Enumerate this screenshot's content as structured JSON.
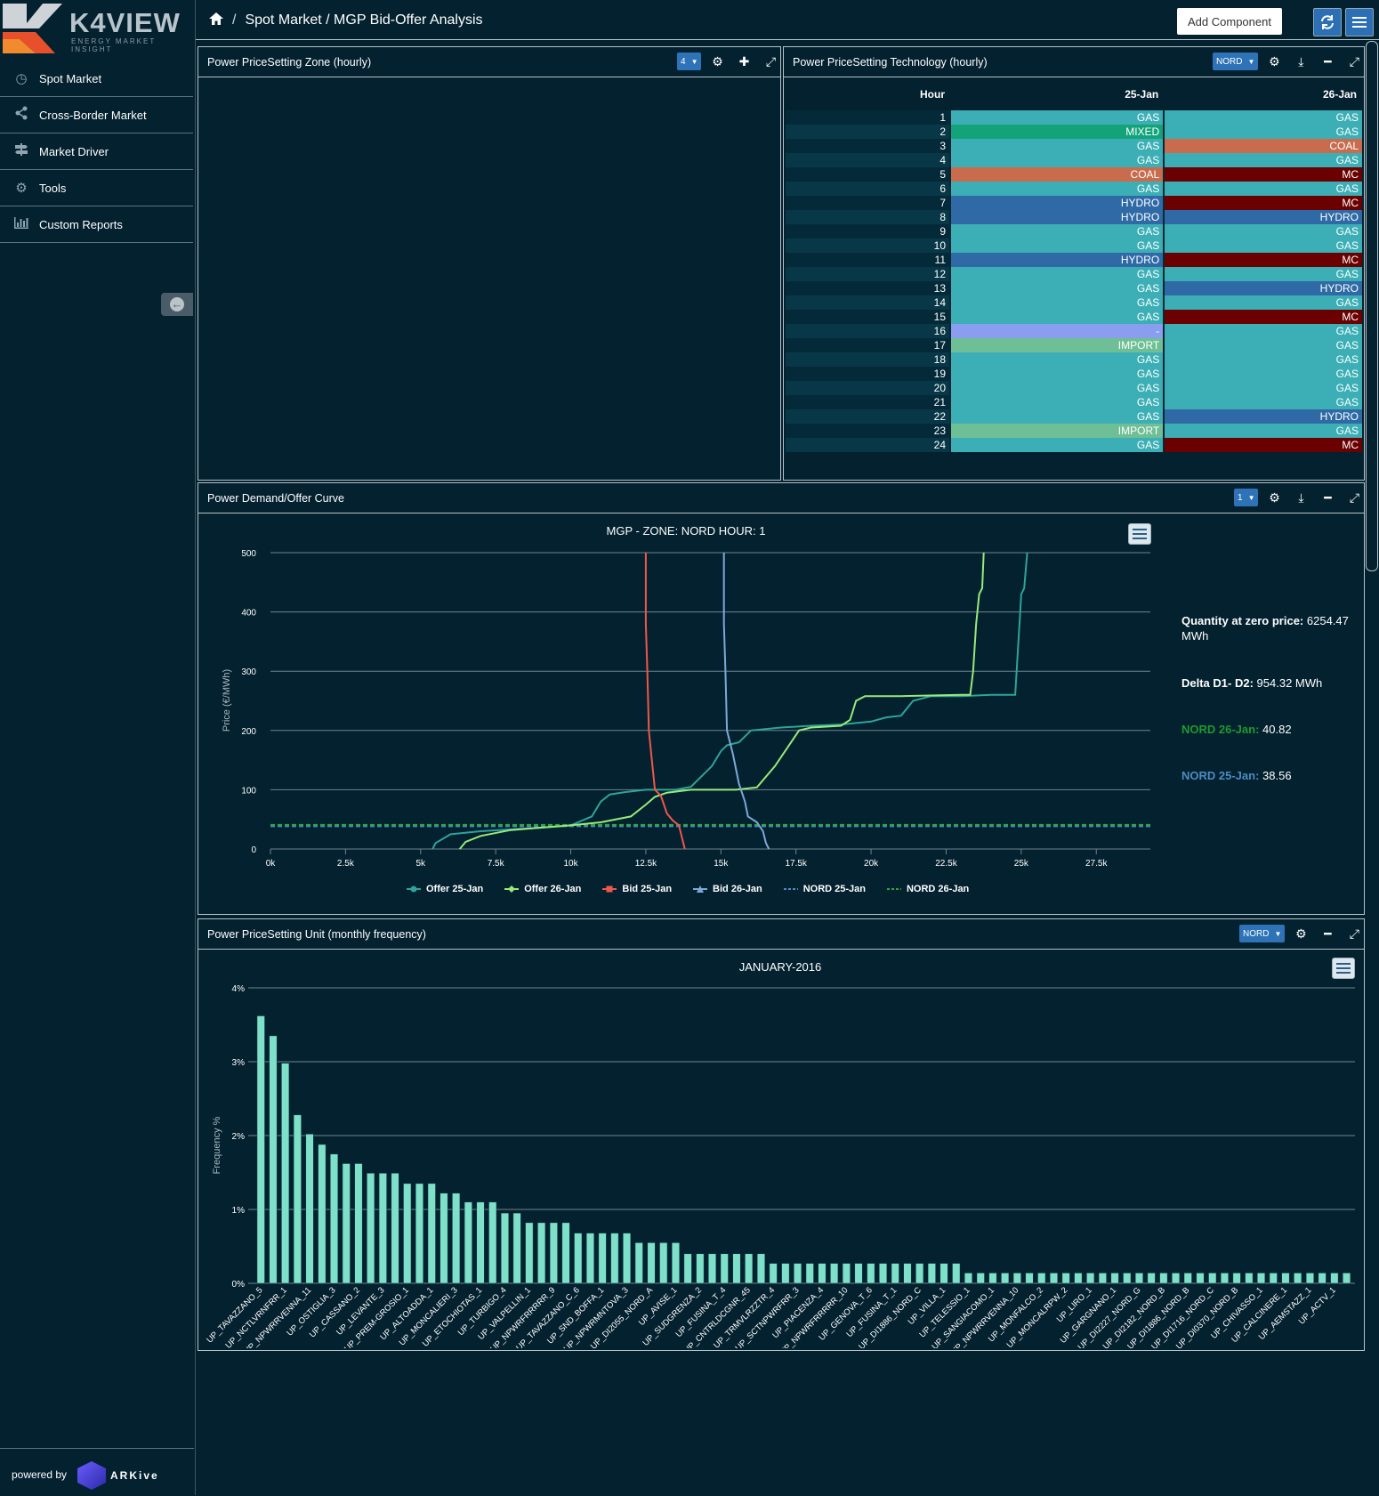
{
  "brand": {
    "name": "K4VIEW",
    "tagline": "ENERGY MARKET INSIGHT"
  },
  "sidebar": {
    "items": [
      {
        "label": "Spot Market",
        "icon": "clock-icon"
      },
      {
        "label": "Cross-Border Market",
        "icon": "share-icon"
      },
      {
        "label": "Market Driver",
        "icon": "signpost-icon"
      },
      {
        "label": "Tools",
        "icon": "gear-icon"
      },
      {
        "label": "Custom Reports",
        "icon": "bar-chart-icon"
      }
    ],
    "powered_by": "powered by",
    "powered_brand": "ARKive"
  },
  "header": {
    "breadcrumb_sep": "/",
    "breadcrumb": "Spot Market / MGP Bid-Offer Analysis",
    "add_component": "Add Component"
  },
  "panels": {
    "zone": {
      "title": "Power PriceSetting Zone (hourly)",
      "select": "4"
    },
    "tech": {
      "title": "Power PriceSetting Technology (hourly)",
      "select": "NORD"
    },
    "curve": {
      "title": "Power Demand/Offer Curve",
      "select": "1"
    },
    "unit": {
      "title": "Power PriceSetting Unit (monthly frequency)",
      "select": "NORD"
    }
  },
  "tech_table": {
    "headers": [
      "Hour",
      "25-Jan",
      "26-Jan"
    ],
    "colors": {
      "GAS": "#3cafb6",
      "MIXED": "#13a37a",
      "COAL": "#c86c4d",
      "MC": "#6a0000",
      "HYDRO": "#2f6aa6",
      "IMPORT": "#6fbf96",
      "-": "#8a9ef0"
    },
    "rows": [
      {
        "hour": "1",
        "d1": "GAS",
        "d2": "GAS"
      },
      {
        "hour": "2",
        "d1": "MIXED",
        "d2": "GAS"
      },
      {
        "hour": "3",
        "d1": "GAS",
        "d2": "COAL"
      },
      {
        "hour": "4",
        "d1": "GAS",
        "d2": "GAS"
      },
      {
        "hour": "5",
        "d1": "COAL",
        "d2": "MC"
      },
      {
        "hour": "6",
        "d1": "GAS",
        "d2": "GAS"
      },
      {
        "hour": "7",
        "d1": "HYDRO",
        "d2": "MC"
      },
      {
        "hour": "8",
        "d1": "HYDRO",
        "d2": "HYDRO"
      },
      {
        "hour": "9",
        "d1": "GAS",
        "d2": "GAS"
      },
      {
        "hour": "10",
        "d1": "GAS",
        "d2": "GAS"
      },
      {
        "hour": "11",
        "d1": "HYDRO",
        "d2": "MC"
      },
      {
        "hour": "12",
        "d1": "GAS",
        "d2": "GAS"
      },
      {
        "hour": "13",
        "d1": "GAS",
        "d2": "HYDRO"
      },
      {
        "hour": "14",
        "d1": "GAS",
        "d2": "GAS"
      },
      {
        "hour": "15",
        "d1": "GAS",
        "d2": "MC"
      },
      {
        "hour": "16",
        "d1": "-",
        "d2": "GAS"
      },
      {
        "hour": "17",
        "d1": "IMPORT",
        "d2": "GAS"
      },
      {
        "hour": "18",
        "d1": "GAS",
        "d2": "GAS"
      },
      {
        "hour": "19",
        "d1": "GAS",
        "d2": "GAS"
      },
      {
        "hour": "20",
        "d1": "GAS",
        "d2": "GAS"
      },
      {
        "hour": "21",
        "d1": "GAS",
        "d2": "GAS"
      },
      {
        "hour": "22",
        "d1": "GAS",
        "d2": "HYDRO"
      },
      {
        "hour": "23",
        "d1": "IMPORT",
        "d2": "GAS"
      },
      {
        "hour": "24",
        "d1": "GAS",
        "d2": "MC"
      }
    ]
  },
  "info": {
    "qty_label": "Quantity at zero price:",
    "qty_value": "6254.47",
    "qty_unit": "MWh",
    "delta_label": "Delta D1- D2:",
    "delta_value": "954.32 MWh",
    "nord26_label": "NORD 26-Jan:",
    "nord26_value": "40.82",
    "nord26_color": "#1f9a2e",
    "nord25_label": "NORD 25-Jan:",
    "nord25_value": "38.56",
    "nord25_color": "#4d8cc2"
  },
  "chart_data": [
    {
      "type": "line",
      "title": "MGP - ZONE: NORD HOUR: 1",
      "ylabel": "Price (€/MWh)",
      "xlabel": "",
      "xlim": [
        0,
        29300
      ],
      "ylim": [
        0,
        500
      ],
      "x_ticks": [
        "0k",
        "2.5k",
        "5k",
        "7.5k",
        "10k",
        "12.5k",
        "15k",
        "17.5k",
        "20k",
        "22.5k",
        "25k",
        "27.5k"
      ],
      "y_ticks": [
        "0",
        "100",
        "200",
        "300",
        "400",
        "500"
      ],
      "series": [
        {
          "name": "Offer 25-Jan",
          "color": "#2fa39a",
          "points": [
            [
              5400,
              0
            ],
            [
              5500,
              10
            ],
            [
              6000,
              25
            ],
            [
              7000,
              30
            ],
            [
              8000,
              33
            ],
            [
              9000,
              36
            ],
            [
              10000,
              40
            ],
            [
              10700,
              55
            ],
            [
              11000,
              80
            ],
            [
              11300,
              92
            ],
            [
              11800,
              96
            ],
            [
              12500,
              100
            ],
            [
              13500,
              100
            ],
            [
              14000,
              105
            ],
            [
              14700,
              140
            ],
            [
              15000,
              165
            ],
            [
              15200,
              175
            ],
            [
              15600,
              180
            ],
            [
              16000,
              200
            ],
            [
              17000,
              205
            ],
            [
              18000,
              208
            ],
            [
              19000,
              210
            ],
            [
              20000,
              215
            ],
            [
              20500,
              222
            ],
            [
              21000,
              225
            ],
            [
              21400,
              250
            ],
            [
              22000,
              258
            ],
            [
              23000,
              258
            ],
            [
              24000,
              260
            ],
            [
              24800,
              260
            ],
            [
              25000,
              430
            ],
            [
              25100,
              440
            ],
            [
              25200,
              500
            ]
          ]
        },
        {
          "name": "Offer 26-Jan",
          "color": "#98ea78",
          "points": [
            [
              6300,
              0
            ],
            [
              6500,
              12
            ],
            [
              7000,
              22
            ],
            [
              8000,
              32
            ],
            [
              9000,
              36
            ],
            [
              10000,
              40
            ],
            [
              11000,
              45
            ],
            [
              12000,
              55
            ],
            [
              12500,
              75
            ],
            [
              12800,
              88
            ],
            [
              13200,
              95
            ],
            [
              14000,
              100
            ],
            [
              15500,
              100
            ],
            [
              16200,
              104
            ],
            [
              16800,
              140
            ],
            [
              17200,
              170
            ],
            [
              17600,
              200
            ],
            [
              18000,
              205
            ],
            [
              19000,
              208
            ],
            [
              19300,
              218
            ],
            [
              19500,
              250
            ],
            [
              19800,
              258
            ],
            [
              21000,
              258
            ],
            [
              23000,
              260
            ],
            [
              23300,
              260
            ],
            [
              23400,
              300
            ],
            [
              23500,
              380
            ],
            [
              23600,
              430
            ],
            [
              23700,
              440
            ],
            [
              23750,
              500
            ]
          ]
        },
        {
          "name": "Bid 25-Jan",
          "color": "#f0564b",
          "points": [
            [
              12500,
              500
            ],
            [
              12500,
              380
            ],
            [
              12550,
              300
            ],
            [
              12600,
              200
            ],
            [
              12700,
              150
            ],
            [
              12800,
              100
            ],
            [
              13000,
              90
            ],
            [
              13200,
              60
            ],
            [
              13400,
              48
            ],
            [
              13600,
              40
            ],
            [
              13700,
              20
            ],
            [
              13800,
              0
            ]
          ]
        },
        {
          "name": "Bid 26-Jan",
          "color": "#7fa8d8",
          "points": [
            [
              15100,
              500
            ],
            [
              15100,
              380
            ],
            [
              15150,
              300
            ],
            [
              15200,
              200
            ],
            [
              15400,
              160
            ],
            [
              15600,
              110
            ],
            [
              15800,
              80
            ],
            [
              15900,
              55
            ],
            [
              16200,
              45
            ],
            [
              16400,
              30
            ],
            [
              16500,
              10
            ],
            [
              16600,
              0
            ]
          ]
        }
      ],
      "hlines": [
        {
          "name": "NORD 25-Jan",
          "value": 38.56,
          "color": "#4d8cc2"
        },
        {
          "name": "NORD 26-Jan",
          "value": 40.82,
          "color": "#2aa83a"
        }
      ],
      "legend": [
        "Offer 25-Jan",
        "Offer 26-Jan",
        "Bid 25-Jan",
        "Bid 26-Jan",
        "NORD 25-Jan",
        "NORD 26-Jan"
      ],
      "legend_position": "bottom-center"
    },
    {
      "type": "bar",
      "title": "JANUARY-2016",
      "ylabel": "Frequency %",
      "xlabel": "",
      "ylim": [
        0,
        4
      ],
      "y_ticks": [
        "0%",
        "1%",
        "2%",
        "3%",
        "4%"
      ],
      "bar_color": "#7ee0c8",
      "categories": [
        "UP_TAVAZZANO_5",
        "UP_NCTLVRNFRR_1",
        "UP_NPWRRVENNA_11",
        "UP_OSTIGLIA_3",
        "UP_CASSANO_2",
        "UP_LEVANTE_3",
        "UP_PREM-GROSIO_1",
        "UP_ALTOADDA_1",
        "UP_MONCALIERI_3",
        "UP_ETOCHIOTAS_1",
        "UP_TURBIGO_4",
        "UP_VALPELLIN_1",
        "UP_NPWRFRRRRR_9",
        "UP_TAVAZZANO_C_6",
        "UP_SND_BOFFA_1",
        "UP_NPWRMNTOVA_3",
        "UP_DI2055_NORD_A",
        "UP_AVISE_1",
        "UP_SUDGRENZA_2",
        "UP_FUSINA_T_4",
        "UP_CNTRLDCGNR_45",
        "UP_TRMVLRZZTR_4",
        "UP_SCTNPWRFRR_3",
        "UP_PIACENZA_4",
        "UP_NPWRFRRRRR_10",
        "UP_GENOVA_T_6",
        "UP_FUSINA_T_1",
        "UP_DI1886_NORD_C",
        "UP_VILLA_1",
        "UP_TELESSIO_1",
        "UP_SANGIACOMO_1",
        "UP_NPWRRVENNA_10",
        "UP_MONFALCO_2",
        "UP_MONCALRPW_2",
        "UP_LIRO_1",
        "UP_GARGNANO_1",
        "UP_DI2227_NORD_G",
        "UP_DI2182_NORD_B",
        "UP_DI1886_NORD_B",
        "UP_DI1716_NORD_C",
        "UP_DI0370_NORD_B",
        "UP_CHIVASSO_1",
        "UP_CALCINERE_1",
        "UP_AEMSTAZZ_1",
        "UP_ACTV_1"
      ],
      "values": [
        3.62,
        3.35,
        2.98,
        2.28,
        2.02,
        1.88,
        1.75,
        1.62,
        1.62,
        1.49,
        1.49,
        1.49,
        1.35,
        1.35,
        1.35,
        1.22,
        1.22,
        1.1,
        1.1,
        1.1,
        0.95,
        0.95,
        0.82,
        0.82,
        0.82,
        0.82,
        0.68,
        0.68,
        0.68,
        0.68,
        0.68,
        0.55,
        0.55,
        0.55,
        0.55,
        0.4,
        0.4,
        0.4,
        0.4,
        0.4,
        0.4,
        0.4,
        0.27,
        0.27,
        0.27,
        0.27,
        0.27,
        0.27,
        0.27,
        0.27,
        0.27,
        0.27,
        0.27,
        0.27,
        0.27,
        0.27,
        0.27,
        0.27,
        0.14,
        0.14,
        0.14,
        0.14,
        0.14,
        0.14,
        0.14,
        0.14,
        0.14,
        0.14,
        0.14,
        0.14,
        0.14,
        0.14,
        0.14,
        0.14,
        0.14,
        0.14,
        0.14,
        0.14,
        0.14,
        0.14,
        0.14,
        0.14,
        0.14,
        0.14,
        0.14,
        0.14,
        0.14,
        0.14,
        0.14,
        0.14
      ]
    }
  ]
}
